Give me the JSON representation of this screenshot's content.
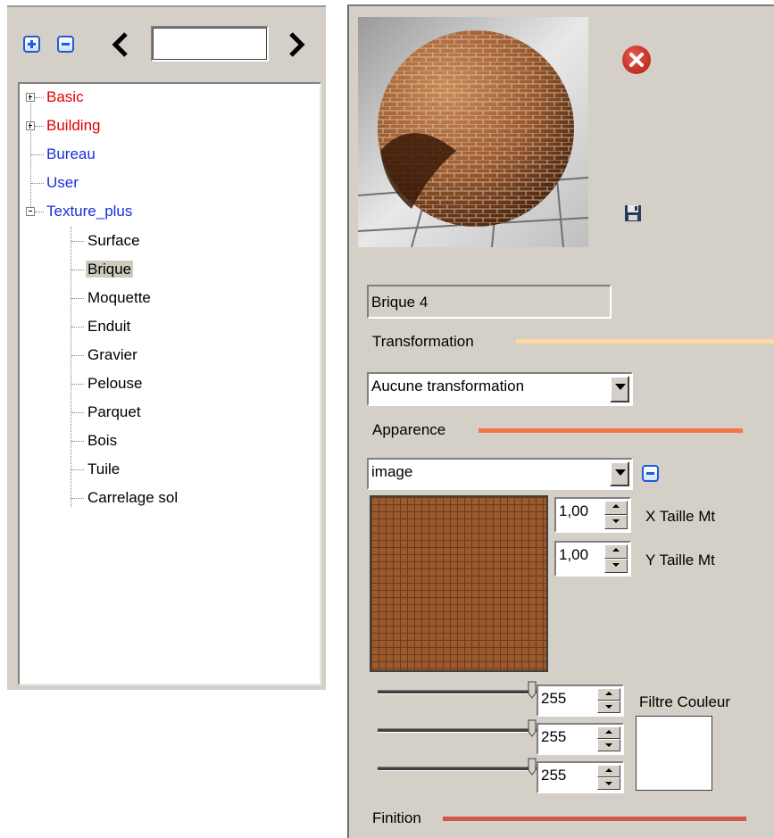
{
  "toolbar": {
    "search_value": ""
  },
  "tree": {
    "items": [
      {
        "label": "Basic",
        "color": "#e00000"
      },
      {
        "label": "Building",
        "color": "#e00000"
      },
      {
        "label": "Bureau",
        "color": "#1a2fd8"
      },
      {
        "label": "User",
        "color": "#1a2fd8"
      },
      {
        "label": "Texture_plus",
        "color": "#1a2fd8"
      }
    ],
    "children": [
      "Surface",
      "Brique",
      "Moquette",
      "Enduit",
      "Gravier",
      "Pelouse",
      "Parquet",
      "Bois",
      "Tuile",
      "Carrelage sol"
    ],
    "selected": "Brique"
  },
  "material": {
    "name": "Brique 4",
    "transformation_label": "Transformation",
    "transformation_value": "Aucune transformation",
    "appearance_label": "Apparence",
    "appearance_value": "image",
    "x_size": "1,00",
    "x_size_label": "X Taille Mt",
    "y_size": "1,00",
    "y_size_label": "Y Taille Mt",
    "color_filter_label": "Filtre Couleur",
    "rgb": [
      "255",
      "255",
      "255"
    ],
    "finish_label": "Finition",
    "accent_colors": {
      "transformation_line": "#ffd9a0",
      "appearance_line": "#f07848",
      "finish_line": "#d0584e"
    }
  }
}
